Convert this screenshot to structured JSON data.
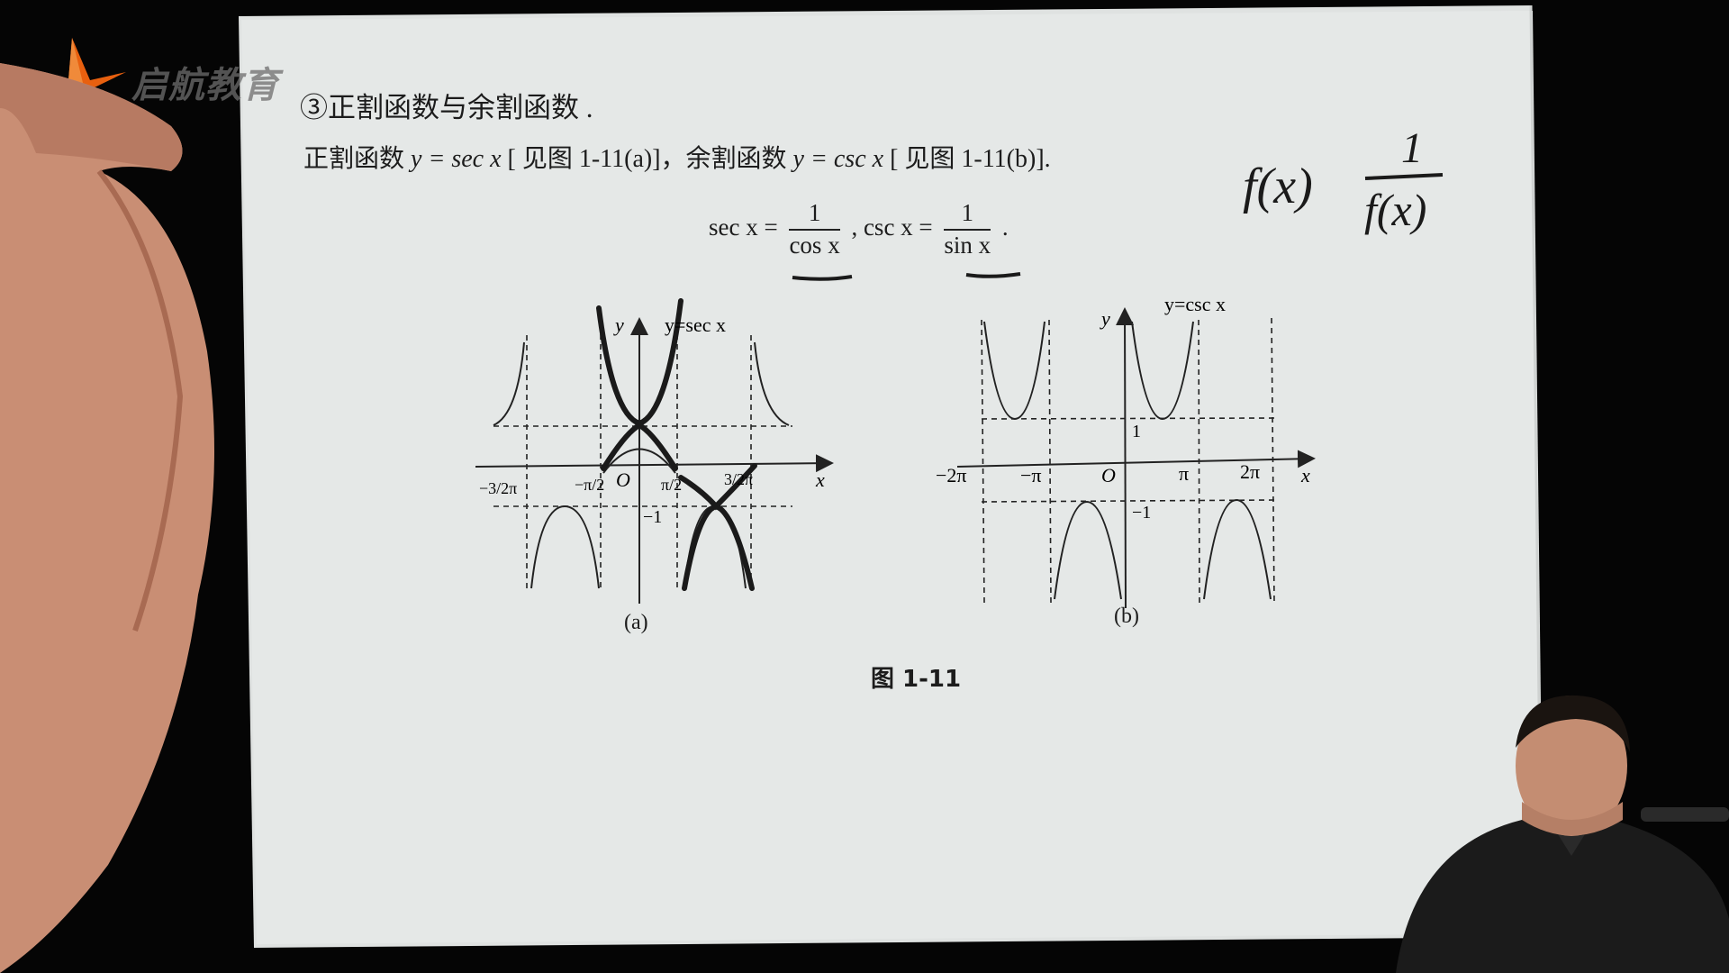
{
  "logo": {
    "text": "启航教育",
    "color": "#e8600f"
  },
  "section": {
    "title": "③正割函数与余割函数 ."
  },
  "intro": {
    "p1": "正割函数",
    "f1": "y = sec x",
    "p2": " [ 见图 1-11(a)]，余割函数",
    "f2": "y = csc x",
    "p3": " [ 见图 1-11(b)]."
  },
  "formula": {
    "lhs1": "sec x =",
    "num1": "1",
    "den1": "cos x",
    "sep": ",  csc x =",
    "num2": "1",
    "den2": "sin x",
    "end": " ."
  },
  "graph_a": {
    "curve_label": "y=sec x",
    "x_label": "x",
    "y_label": "y",
    "origin": "O",
    "ticks": [
      "−3/2π",
      "−π/2",
      "π/2",
      "3/2π"
    ],
    "minus_one": "−1",
    "caption": "(a)"
  },
  "graph_b": {
    "curve_label": "y=csc x",
    "x_label": "x",
    "y_label": "y",
    "origin": "O",
    "ticks": [
      "−2π",
      "−π",
      "π",
      "2π"
    ],
    "one": "1",
    "minus_one": "−1",
    "caption": "(b)"
  },
  "figure": {
    "caption": "图 1-11"
  },
  "handwriting": {
    "top": "f(x)",
    "frac_num": "1",
    "frac_den": "f(x)"
  },
  "colors": {
    "paper": "#e3e6e5",
    "background": "#050505",
    "ink": "#1c1c1c",
    "pen": "#1a1a1a"
  }
}
